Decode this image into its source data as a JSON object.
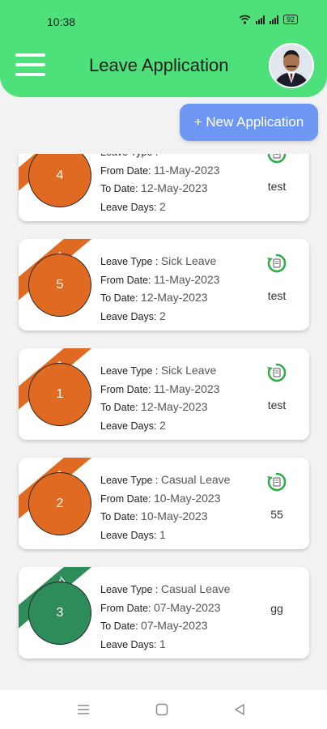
{
  "status_bar": {
    "time": "10:38",
    "battery": "92"
  },
  "header": {
    "title": "Leave Application"
  },
  "actions": {
    "new_application_label": "+ New Application"
  },
  "labels": {
    "leave_type": "Leave Type :",
    "from_date": "From Date:",
    "to_date": "To Date:",
    "leave_days": "Leave Days:"
  },
  "applications": [
    {
      "status": "Pending",
      "id": "4",
      "leave_type": "",
      "from_date": "11-May-2023",
      "to_date": "12-May-2023",
      "leave_days": "2",
      "remark": "test",
      "color": "#e06a22"
    },
    {
      "status": "Pending",
      "id": "5",
      "leave_type": "Sick Leave",
      "from_date": "11-May-2023",
      "to_date": "12-May-2023",
      "leave_days": "2",
      "remark": "test",
      "color": "#e06a22"
    },
    {
      "status": "Pending",
      "id": "1",
      "leave_type": "Sick Leave",
      "from_date": "11-May-2023",
      "to_date": "12-May-2023",
      "leave_days": "2",
      "remark": "test",
      "color": "#e06a22"
    },
    {
      "status": "Pending",
      "id": "2",
      "leave_type": "Casual Leave",
      "from_date": "10-May-2023",
      "to_date": "10-May-2023",
      "leave_days": "1",
      "remark": "55",
      "color": "#e06a22"
    },
    {
      "status": "Approved",
      "id": "3",
      "leave_type": "Casual Leave",
      "from_date": "07-May-2023",
      "to_date": "07-May-2023",
      "leave_days": "1",
      "remark": "gg",
      "color": "#2e8b5a"
    }
  ],
  "colors": {
    "header": "#4ee07a",
    "button": "#6d97f3",
    "pending": "#e06a22",
    "approved": "#2e8b5a",
    "icon": "#2fae4a"
  },
  "icons": {
    "menu": "hamburger-icon",
    "pending_status": "refresh-document-icon"
  }
}
